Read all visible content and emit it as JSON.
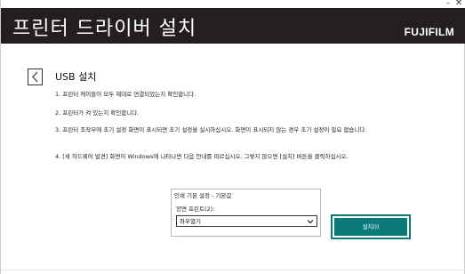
{
  "window": {
    "minimize_glyph": "–",
    "close_glyph": "✕"
  },
  "header": {
    "title": "프린터 드라이버 설치",
    "brand": "FUJIFILM"
  },
  "page": {
    "title": "USB 설치",
    "steps": [
      "1. 프린터 케이블이 모두 제대로 연결되었는지 확인합니다.",
      "2. 프린터가 켜 있는지 확인합니다.",
      "3. 프린터 조작부에 초기 설정 화면이 표시되면 초기 설정을 실시하십시오. 화면이 표시되지 않는 경우 초기 설정이 필요 없습니다.",
      "4. [새 하드웨어 발견] 화면이 Windows에 나타나면 다음 안내를 따르십시오. 그렇지 않으면 [설치] 버튼을 클릭하십시오."
    ]
  },
  "settings": {
    "title": "인쇄 기본 설정 - 기본값",
    "duplex_label": "양면 프린트(2):",
    "duplex_value": "좌우열기"
  },
  "install_button_label": "설치(I)",
  "colors": {
    "header_bg": "#231f20",
    "accent": "#0a7b7a"
  }
}
